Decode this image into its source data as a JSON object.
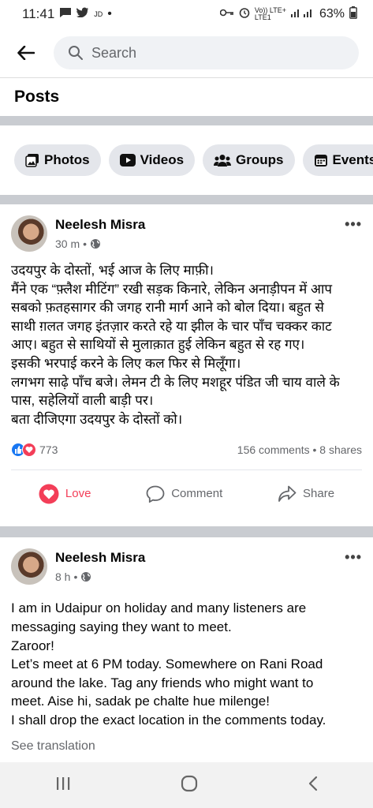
{
  "status_bar": {
    "time": "11:41",
    "small_text": "JD",
    "dot": "•",
    "network_top": "Vo)) LTE+",
    "network_bottom": "LTE1",
    "battery": "63%"
  },
  "search": {
    "placeholder": "Search"
  },
  "section_title": "Posts",
  "chips": [
    "Photos",
    "Videos",
    "Groups",
    "Events"
  ],
  "posts": [
    {
      "author": "Neelesh Misra",
      "time": "30 m",
      "sep": "•",
      "lines": [
        "उदयपुर के दोस्तों, भई आज के लिए माफ़ी।",
        "मैंने एक “फ़्लैश मीटिंग” रखी सड़क किनारे, लेकिन अनाड़ीपन में आप",
        "सबको फ़तहसागर की जगह रानी मार्ग आने को बोल दिया। बहुत से",
        "साथी ग़लत जगह इंतज़ार करते रहे या झील के चार पाँच चक्कर काट",
        "आए। बहुत से साथियों से मुलाक़ात हुई लेकिन बहुत से रह गए।",
        "इसकी भरपाई करने के लिए कल फिर से मिलूँगा।",
        "लगभग साढ़े पाँच बजे। लेमन टी के लिए मशहूर पंडित जी चाय वाले के",
        "पास, सहेलियों वाली बाड़ी पर।",
        "बता दीजिएगा उदयपुर के दोस्तों को।"
      ],
      "reaction_count": "773",
      "comments_shares": "156 comments • 8 shares",
      "actions": {
        "love": "Love",
        "comment": "Comment",
        "share": "Share"
      }
    },
    {
      "author": "Neelesh Misra",
      "time": "8 h",
      "sep": "•",
      "lines": [
        "I am in Udaipur on holiday and many listeners  are",
        "messaging saying they want to meet.",
        "Zaroor!",
        "Let’s meet at 6 PM today. Somewhere on Rani Road",
        "around the lake. Tag any friends who might want to",
        "meet. Aise hi, sadak pe chalte hue milenge!",
        "I shall drop the exact location in the comments  today."
      ],
      "see_translation": "See translation"
    }
  ],
  "colors": {
    "love": "#f33e58",
    "like": "#1877f2",
    "divider": "#c9ccd1",
    "chip_bg": "#e4e6eb"
  }
}
